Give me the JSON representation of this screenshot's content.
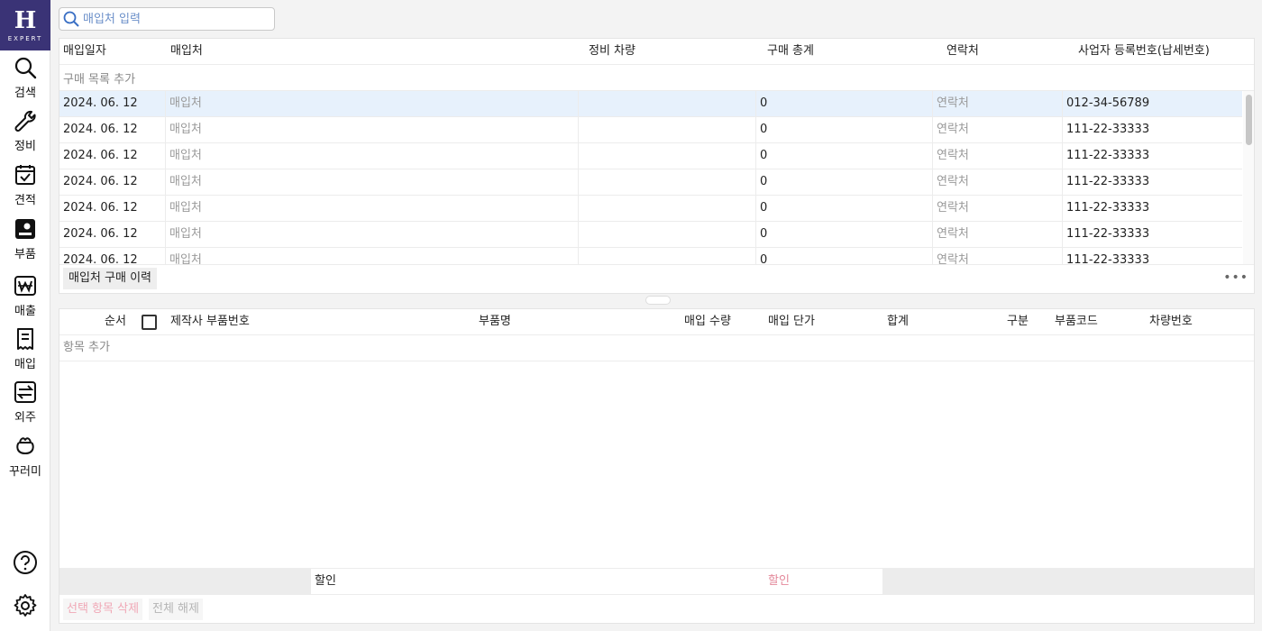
{
  "logo": {
    "letter": "H",
    "text": "EXPERT"
  },
  "nav": [
    {
      "label": "검색",
      "icon": "search-icon"
    },
    {
      "label": "정비",
      "icon": "wrench-icon"
    },
    {
      "label": "견적",
      "icon": "calendar-check-icon"
    },
    {
      "label": "부품",
      "icon": "parts-icon"
    },
    {
      "label": "매출",
      "icon": "won-icon"
    },
    {
      "label": "매입",
      "icon": "receipt-icon"
    },
    {
      "label": "외주",
      "icon": "transfer-icon"
    },
    {
      "label": "꾸러미",
      "icon": "bundle-icon"
    }
  ],
  "search": {
    "placeholder": "매입처 입력"
  },
  "purchase_table": {
    "headers": [
      "매입일자",
      "매입처",
      "정비 차량",
      "구매 총계",
      "연락처",
      "사업자 등록번호(납세번호)"
    ],
    "add_row": "구매 목록 추가",
    "rows": [
      {
        "date": "2024. 06. 12",
        "vendor": "매입처",
        "vehicle": "",
        "total": "0",
        "contact": "연락처",
        "bizno": "012-34-56789"
      },
      {
        "date": "2024. 06. 12",
        "vendor": "매입처",
        "vehicle": "",
        "total": "0",
        "contact": "연락처",
        "bizno": "111-22-33333"
      },
      {
        "date": "2024. 06. 12",
        "vendor": "매입처",
        "vehicle": "",
        "total": "0",
        "contact": "연락처",
        "bizno": "111-22-33333"
      },
      {
        "date": "2024. 06. 12",
        "vendor": "매입처",
        "vehicle": "",
        "total": "0",
        "contact": "연락처",
        "bizno": "111-22-33333"
      },
      {
        "date": "2024. 06. 12",
        "vendor": "매입처",
        "vehicle": "",
        "total": "0",
        "contact": "연락처",
        "bizno": "111-22-33333"
      },
      {
        "date": "2024. 06. 12",
        "vendor": "매입처",
        "vehicle": "",
        "total": "0",
        "contact": "연락처",
        "bizno": "111-22-33333"
      },
      {
        "date": "2024. 06. 12",
        "vendor": "매입처",
        "vehicle": "",
        "total": "0",
        "contact": "연락처",
        "bizno": "111-22-33333"
      }
    ],
    "history_tab": "매입처 구매 이력",
    "more": "•••"
  },
  "items_table": {
    "headers": [
      "순서",
      "제작사 부품번호",
      "부품명",
      "매입 수량",
      "매입 단가",
      "합계",
      "구분",
      "부품코드",
      "차량번호"
    ],
    "add_row": "항목 추가",
    "discount_label": "할인",
    "discount_value": "할인",
    "delete_selected": "선택 항목 삭제",
    "deselect_all": "전체 해제"
  },
  "colors": {
    "brand": "#3a3376",
    "selected_row": "#e7f1fc",
    "danger_text": "#e4899b"
  }
}
